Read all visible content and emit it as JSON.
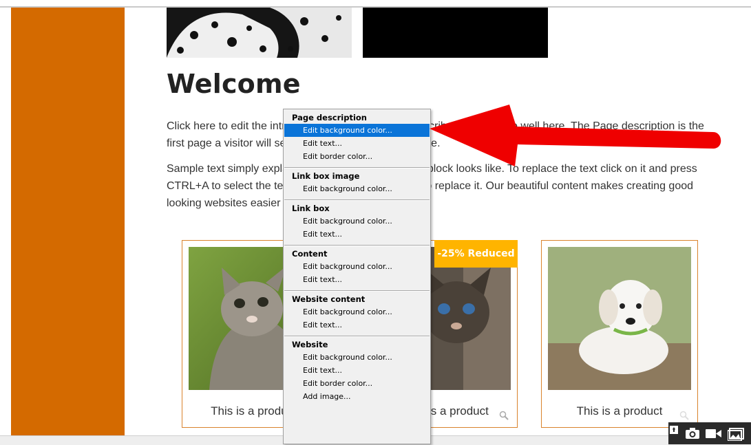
{
  "colors": {
    "sidebar": "#d46a00",
    "accent_border": "#d9822b",
    "badge": "#ffb400",
    "menu_highlight": "#0a74d8",
    "arrow": "#ef0000"
  },
  "page": {
    "heading": "Welcome",
    "paragraph1": "Click here to edit the introduction. It's important to describe your website well here. The Page description is the first page a visitor will see when coming to your website.",
    "paragraph2": "Sample text simply explains how the text in your new block looks like. To replace the text click on it and press CTRL+A to select the text. Then enter your own text to replace it. Our beautiful content makes creating good looking websites easier than ever."
  },
  "products": [
    {
      "title": "This is a product",
      "image": "kitten-photo"
    },
    {
      "title": "This is a product",
      "image": "tabby-kitten-photo",
      "badge": "-25% Reduced"
    },
    {
      "title": "This is a product",
      "image": "white-puppy-photo"
    }
  ],
  "context_menu": {
    "sections": [
      {
        "title": "Page description",
        "items": [
          "Edit background color...",
          "Edit text...",
          "Edit border color..."
        ]
      },
      {
        "title": "Link box image",
        "items": [
          "Edit background color..."
        ]
      },
      {
        "title": "Link box",
        "items": [
          "Edit background color...",
          "Edit text..."
        ]
      },
      {
        "title": "Content",
        "items": [
          "Edit background color...",
          "Edit text..."
        ]
      },
      {
        "title": "Website content",
        "items": [
          "Edit background color...",
          "Edit text..."
        ]
      },
      {
        "title": "Website",
        "items": [
          "Edit background color...",
          "Edit text...",
          "Edit border color...",
          "Add image..."
        ]
      }
    ],
    "highlighted_item": "Edit background color..."
  },
  "toolbar": {
    "icons": [
      "pin-icon",
      "camera-icon",
      "video-icon",
      "image-icon"
    ]
  }
}
